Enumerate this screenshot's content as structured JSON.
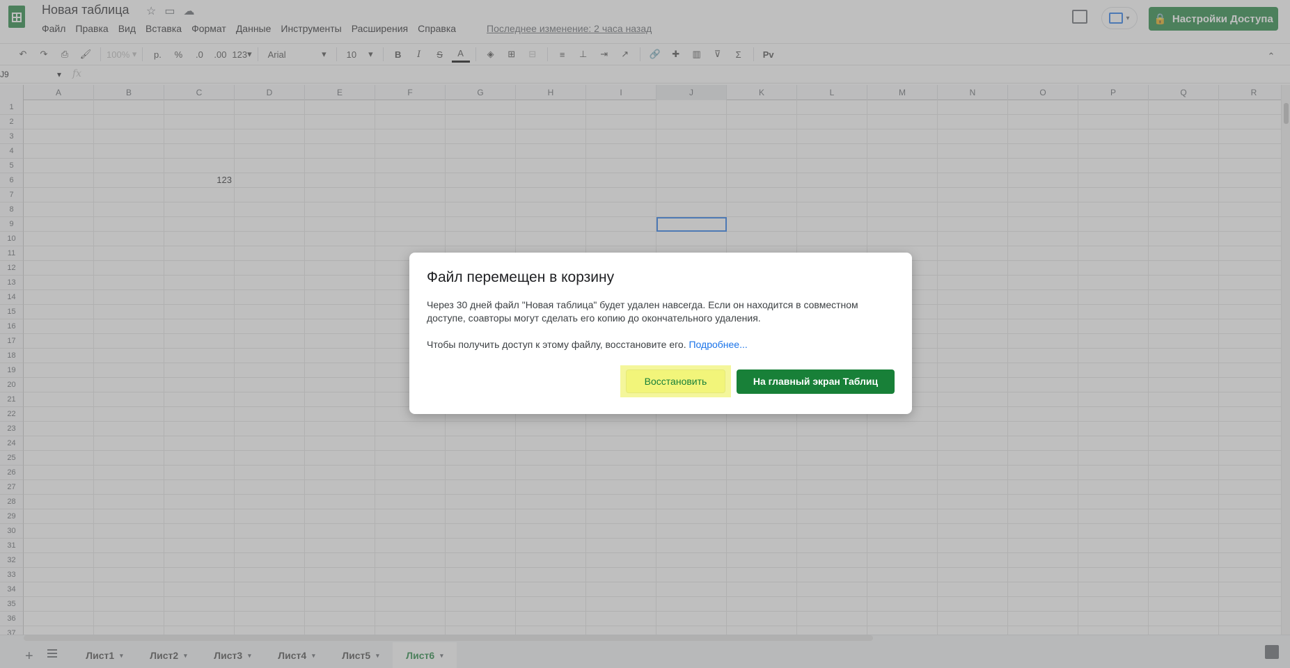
{
  "header": {
    "doc_title": "Новая таблица",
    "menu": [
      "Файл",
      "Правка",
      "Вид",
      "Вставка",
      "Формат",
      "Данные",
      "Инструменты",
      "Расширения",
      "Справка"
    ],
    "last_edit": "Последнее изменение: 2 часа назад",
    "share_label": "Настройки Доступа",
    "share_icon": "🔒"
  },
  "toolbar": {
    "zoom": "100%",
    "currency": "р.",
    "percent": "%",
    "dec_decrease": ".0",
    "dec_increase": ".00",
    "number_format": "123",
    "font": "Arial",
    "font_size": "10",
    "caret": "▾",
    "sigma": "Σ",
    "input_tools": "Рv"
  },
  "formula_bar": {
    "name_box": "J9",
    "fx": "fx"
  },
  "grid": {
    "columns": [
      "A",
      "B",
      "C",
      "D",
      "E",
      "F",
      "G",
      "H",
      "I",
      "J",
      "K",
      "L",
      "M",
      "N",
      "O",
      "P",
      "Q",
      "R"
    ],
    "rows": [
      "1",
      "2",
      "3",
      "4",
      "5",
      "6",
      "7",
      "8",
      "9",
      "10",
      "11",
      "12",
      "13",
      "14",
      "15",
      "16",
      "17",
      "18",
      "19",
      "20",
      "21",
      "22",
      "23",
      "24",
      "25",
      "26",
      "27",
      "28",
      "29",
      "30",
      "31",
      "32",
      "33",
      "34",
      "35",
      "36",
      "37"
    ],
    "cells": [
      {
        "row": 6,
        "col": "C",
        "value": "123"
      }
    ],
    "active_cell": {
      "row": 9,
      "col": "J"
    }
  },
  "sheets": {
    "add": "+",
    "tabs": [
      "Лист1",
      "Лист2",
      "Лист3",
      "Лист4",
      "Лист5",
      "Лист6"
    ],
    "active": "Лист6"
  },
  "dialog": {
    "title": "Файл перемещен в корзину",
    "body": "Через 30 дней файл \"Новая таблица\" будет удален навсегда. Если он находится в совместном доступе, соавторы могут сделать его копию до окончательного удаления.",
    "body2": "Чтобы получить доступ к этому файлу, восстановите его.",
    "link": "Подробнее...",
    "restore_label": "Восстановить",
    "home_label": "На главный экран Таблиц"
  },
  "colors": {
    "brand_green": "#188038",
    "highlight_yellow": "#f4f69b",
    "link_blue": "#1a73e8"
  }
}
